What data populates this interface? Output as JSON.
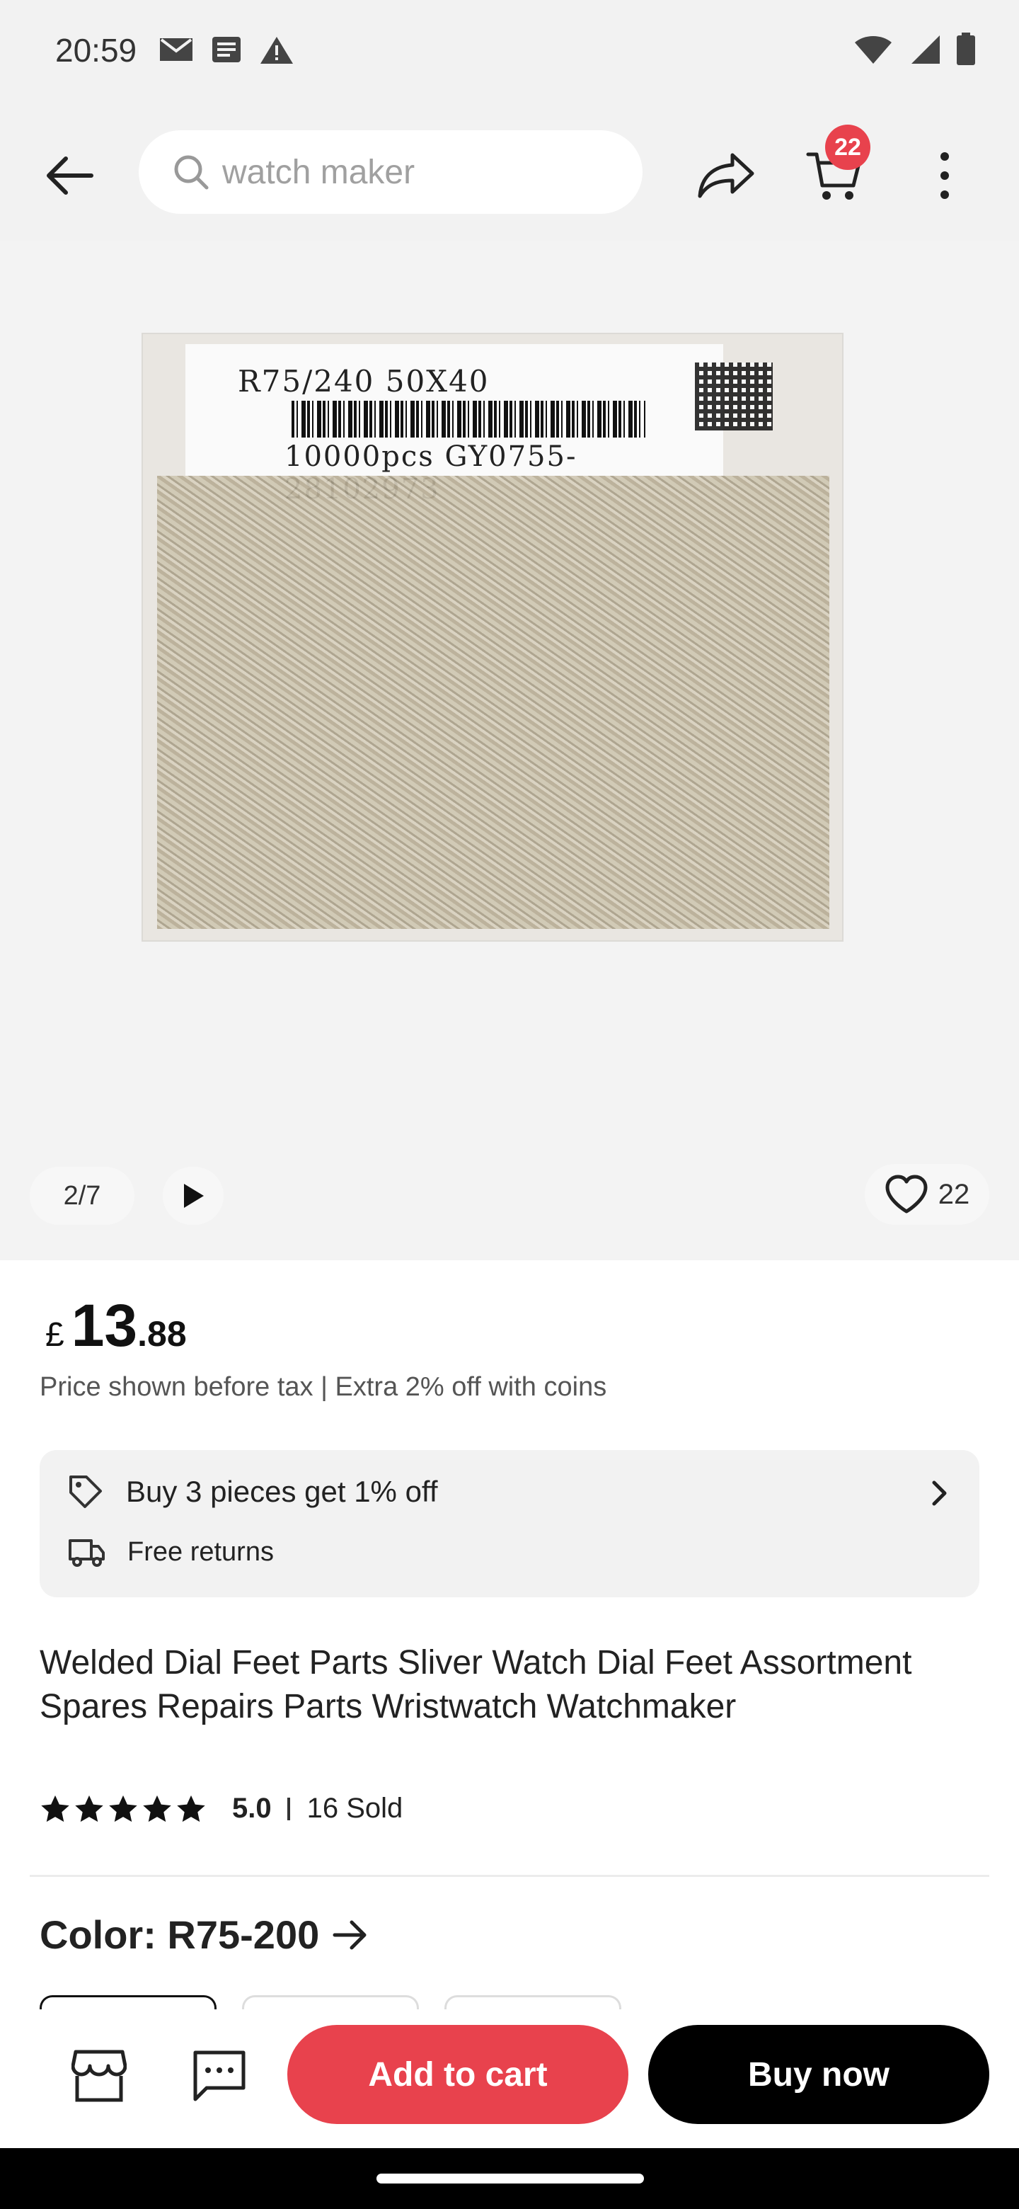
{
  "status_bar": {
    "time": "20:59",
    "left_icons": [
      "mail-icon",
      "notes-icon",
      "warning-icon"
    ],
    "right_icons": [
      "wifi-icon",
      "signal-icon",
      "battery-icon"
    ]
  },
  "app_bar": {
    "search_placeholder": "watch maker",
    "cart_count": "22"
  },
  "gallery": {
    "page_indicator": "2/7",
    "favorites_count": "22",
    "photo_label": {
      "line1": "R75/240  50X40",
      "line3": "10000pcs GY0755-28102973"
    }
  },
  "price": {
    "currency": "£",
    "integer": "13",
    "decimal": ".88",
    "note": "Price shown before tax | Extra 2% off with coins"
  },
  "promo": {
    "deal": "Buy 3 pieces get 1% off",
    "returns": "Free returns"
  },
  "product": {
    "title": "Welded Dial Feet Parts Sliver Watch Dial Feet Assortment Spares Repairs Parts Wristwatch Watchmaker",
    "rating": "5.0",
    "rating_stars": 5,
    "sold": "16 Sold"
  },
  "color": {
    "label": "Color: R75-200"
  },
  "actions": {
    "add_to_cart": "Add to cart",
    "buy_now": "Buy now"
  },
  "colors": {
    "accent": "#e8424d",
    "buy_bg": "#000000",
    "surface": "#f2f2f2"
  }
}
